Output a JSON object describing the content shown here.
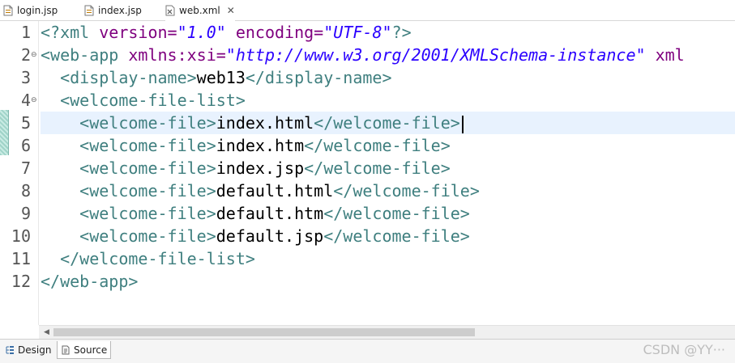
{
  "tabs": [
    {
      "label": "login.jsp",
      "icon": "jsp-file-icon",
      "active": false
    },
    {
      "label": "index.jsp",
      "icon": "jsp-file-icon",
      "active": false
    },
    {
      "label": "web.xml",
      "icon": "xml-file-icon",
      "active": true,
      "close": "✕"
    }
  ],
  "editor": {
    "line_numbers": [
      "1",
      "2",
      "3",
      "4",
      "5",
      "6",
      "7",
      "8",
      "9",
      "10",
      "11",
      "12"
    ],
    "current_line": 5,
    "fold_marker": "⊖",
    "lines": [
      [
        {
          "t": "<?",
          "c": "decl"
        },
        {
          "t": "xml",
          "c": "decl"
        },
        {
          "t": " version=",
          "c": "attr"
        },
        {
          "t": "\"1.0\"",
          "c": "str"
        },
        {
          "t": " encoding=",
          "c": "attr"
        },
        {
          "t": "\"UTF-8\"",
          "c": "str"
        },
        {
          "t": "?>",
          "c": "decl"
        }
      ],
      [
        {
          "t": "<web-app",
          "c": "tag"
        },
        {
          "t": " xmlns:xsi=",
          "c": "attr"
        },
        {
          "t": "\"http://www.w3.org/2001/XMLSchema-instance\"",
          "c": "str"
        },
        {
          "t": " xml",
          "c": "attr"
        }
      ],
      [
        {
          "t": "  <display-name>",
          "c": "tag"
        },
        {
          "t": "web13",
          "c": "txt"
        },
        {
          "t": "</display-name>",
          "c": "tag"
        }
      ],
      [
        {
          "t": "  <welcome-file-list>",
          "c": "tag"
        }
      ],
      [
        {
          "t": "    <welcome-file>",
          "c": "tag"
        },
        {
          "t": "index.html",
          "c": "txt"
        },
        {
          "t": "</welcome-file>",
          "c": "tag"
        }
      ],
      [
        {
          "t": "    <welcome-file>",
          "c": "tag"
        },
        {
          "t": "index.htm",
          "c": "txt"
        },
        {
          "t": "</welcome-file>",
          "c": "tag"
        }
      ],
      [
        {
          "t": "    <welcome-file>",
          "c": "tag"
        },
        {
          "t": "index.jsp",
          "c": "txt"
        },
        {
          "t": "</welcome-file>",
          "c": "tag"
        }
      ],
      [
        {
          "t": "    <welcome-file>",
          "c": "tag"
        },
        {
          "t": "default.html",
          "c": "txt"
        },
        {
          "t": "</welcome-file>",
          "c": "tag"
        }
      ],
      [
        {
          "t": "    <welcome-file>",
          "c": "tag"
        },
        {
          "t": "default.htm",
          "c": "txt"
        },
        {
          "t": "</welcome-file>",
          "c": "tag"
        }
      ],
      [
        {
          "t": "    <welcome-file>",
          "c": "tag"
        },
        {
          "t": "default.jsp",
          "c": "txt"
        },
        {
          "t": "</welcome-file>",
          "c": "tag"
        }
      ],
      [
        {
          "t": "  </welcome-file-list>",
          "c": "tag"
        }
      ],
      [
        {
          "t": "</web-app>",
          "c": "tag"
        }
      ]
    ],
    "folded_lines": [
      2,
      4
    ]
  },
  "bottom_tabs": [
    {
      "label": "Design",
      "active": false
    },
    {
      "label": "Source",
      "active": true
    }
  ],
  "watermark": "CSDN @YY···",
  "colors": {
    "tag": "#3f7f7f",
    "attribute": "#7f007f",
    "string": "#2a00ff",
    "current_line": "#e8f2fe"
  }
}
